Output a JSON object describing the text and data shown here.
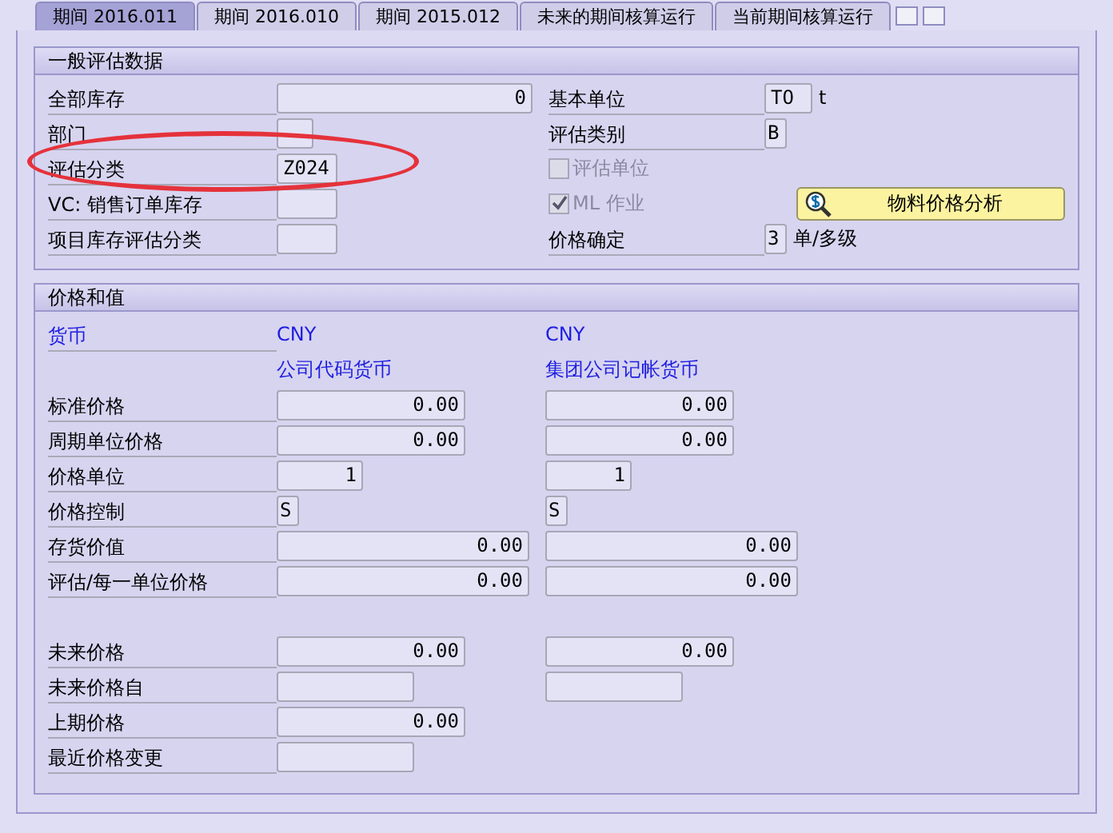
{
  "tabs": [
    {
      "label": "期间 2016.011",
      "selected": true
    },
    {
      "label": "期间 2016.010",
      "selected": false
    },
    {
      "label": "期间 2015.012",
      "selected": false
    },
    {
      "label": "未来的期间核算运行",
      "selected": false
    },
    {
      "label": "当前期间核算运行",
      "selected": false
    }
  ],
  "general": {
    "title": "一般评估数据",
    "left_rows": [
      {
        "label": "全部库存",
        "value": "0",
        "kind": "wide"
      },
      {
        "label": "部门",
        "value": "",
        "kind": "mini"
      },
      {
        "label": "评估分类",
        "value": "Z024",
        "kind": "small"
      },
      {
        "label": "VC: 销售订单库存",
        "value": "",
        "kind": "small"
      },
      {
        "label": "项目库存评估分类",
        "value": "",
        "kind": "small"
      }
    ],
    "right_rows": [
      {
        "kind": "field",
        "label": "基本单位",
        "value": "TO",
        "unit": "t"
      },
      {
        "kind": "field",
        "label": "评估类别",
        "value": "B"
      },
      {
        "kind": "checkbox",
        "label": "评估单位",
        "checked": false,
        "disabled": true
      },
      {
        "kind": "checkbox",
        "label": "ML 作业",
        "checked": true,
        "disabled": true
      },
      {
        "kind": "field",
        "label": "价格确定",
        "value": "3",
        "unit": "单/多级"
      }
    ],
    "button": {
      "label": "物料价格分析"
    }
  },
  "prices": {
    "title": "价格和值",
    "currency": {
      "label": "货币",
      "values": [
        "CNY",
        "CNY"
      ]
    },
    "column_headers": [
      "公司代码货币",
      "集团公司记帐货币"
    ],
    "rows": [
      {
        "label": "标准价格",
        "kind": "medium",
        "values": [
          "0.00",
          "0.00"
        ]
      },
      {
        "label": "周期单位价格",
        "kind": "medium",
        "values": [
          "0.00",
          "0.00"
        ]
      },
      {
        "label": "价格单位",
        "kind": "short",
        "values": [
          "1",
          "1"
        ]
      },
      {
        "label": "价格控制",
        "kind": "tiny",
        "values": [
          "S",
          "S"
        ]
      },
      {
        "label": "存货价值",
        "kind": "long",
        "values": [
          "0.00",
          "0.00"
        ]
      },
      {
        "label": "评估/每一单位价格",
        "kind": "long",
        "values": [
          "0.00",
          "0.00"
        ]
      }
    ],
    "future_rows": [
      {
        "label": "未来价格",
        "fields": [
          {
            "kind": "medium",
            "value": "0.00"
          },
          {
            "kind": "medium",
            "value": "0.00"
          }
        ]
      },
      {
        "label": "未来价格自",
        "fields": [
          {
            "kind": "date"
          },
          {
            "kind": "date"
          }
        ]
      },
      {
        "label": "上期价格",
        "fields": [
          {
            "kind": "medium",
            "value": "0.00"
          }
        ]
      },
      {
        "label": "最近价格变更",
        "fields": [
          {
            "kind": "date"
          }
        ]
      }
    ]
  }
}
